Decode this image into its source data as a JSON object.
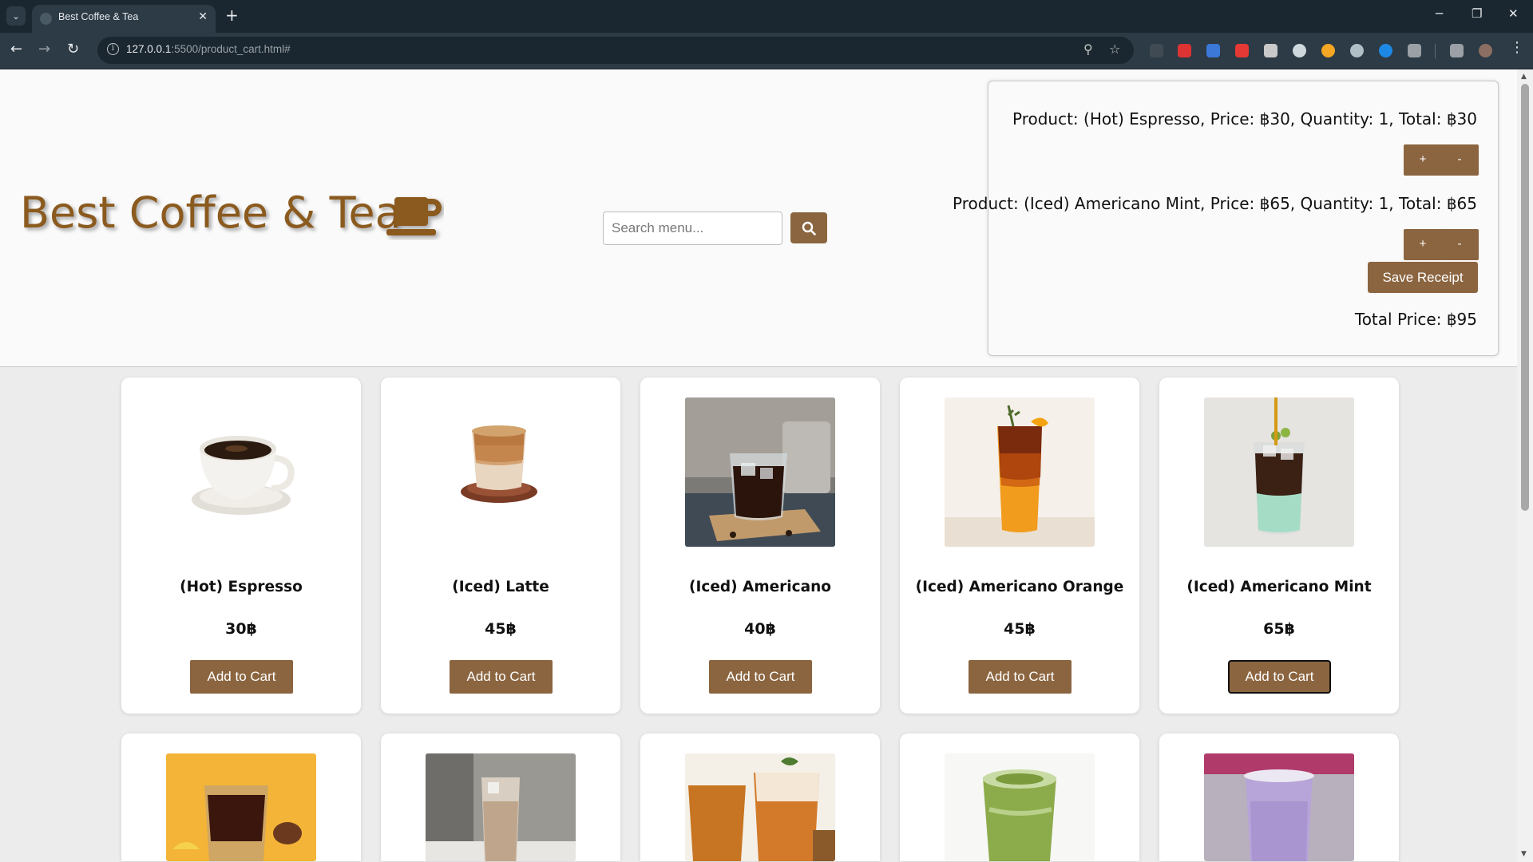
{
  "browser": {
    "tab_title": "Best Coffee & Tea",
    "url_host": "127.0.0.1",
    "url_rest": ":5500/product_cart.html#"
  },
  "header": {
    "brand": "Best Coffee & Tea",
    "search_placeholder": "Search menu..."
  },
  "cart": {
    "items": [
      {
        "line": "Product: (Hot) Espresso, Price: ฿30, Quantity: 1, Total: ฿30",
        "plus": "+",
        "minus": "-"
      },
      {
        "line": "Product: (Iced) Americano Mint, Price: ฿65, Quantity: 1, Total: ฿65",
        "plus": "+",
        "minus": "-"
      }
    ],
    "save_label": "Save Receipt",
    "total_line": "Total Price: ฿95"
  },
  "products": [
    {
      "name": "(Hot) Espresso",
      "price": "30฿",
      "button": "Add to Cart"
    },
    {
      "name": "(Iced) Latte",
      "price": "45฿",
      "button": "Add to Cart"
    },
    {
      "name": "(Iced) Americano",
      "price": "40฿",
      "button": "Add to Cart"
    },
    {
      "name": "(Iced) Americano Orange",
      "price": "45฿",
      "button": "Add to Cart"
    },
    {
      "name": "(Iced) Americano Mint",
      "price": "65฿",
      "button": "Add to Cart"
    }
  ],
  "colors": {
    "brand": "#8b5a1e",
    "button": "#8b6540",
    "page_bg": "#ececec",
    "header_bg": "#fafafa"
  }
}
